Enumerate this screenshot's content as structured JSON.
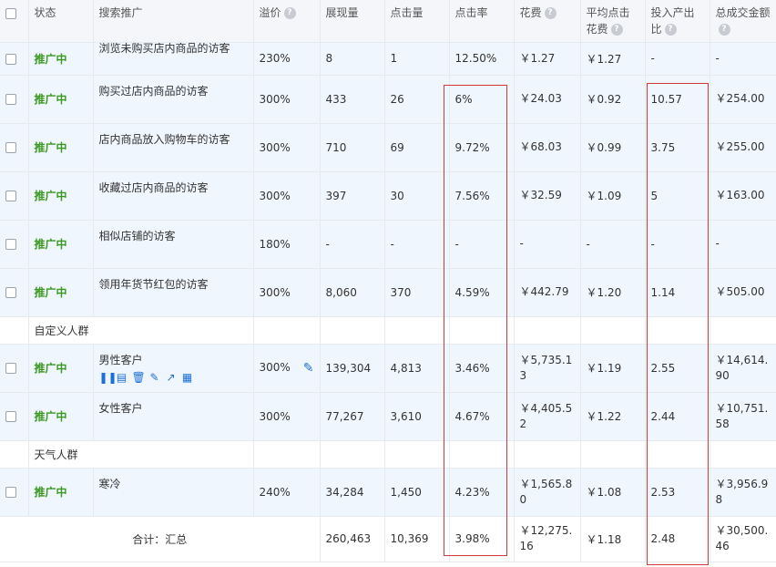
{
  "headers": {
    "status": "状态",
    "name": "搜索推广",
    "premium": "溢价",
    "impressions": "展现量",
    "clicks": "点击量",
    "ctr": "点击率",
    "cost": "花费",
    "cpc": "平均点击花费",
    "roi": "投入产出比",
    "gmv": "总成交金额"
  },
  "rows": [
    {
      "status": "推广中",
      "name": "浏览未购买店内商品的访客",
      "premium": "230%",
      "impressions": "8",
      "clicks": "1",
      "ctr": "12.50%",
      "cost": "￥1.27",
      "cpc": "￥1.27",
      "roi": "-",
      "gmv": "-"
    },
    {
      "status": "推广中",
      "name": "购买过店内商品的访客",
      "premium": "300%",
      "impressions": "433",
      "clicks": "26",
      "ctr": "6%",
      "cost": "￥24.03",
      "cpc": "￥0.92",
      "roi": "10.57",
      "gmv": "￥254.00"
    },
    {
      "status": "推广中",
      "name": "店内商品放入购物车的访客",
      "premium": "300%",
      "impressions": "710",
      "clicks": "69",
      "ctr": "9.72%",
      "cost": "￥68.03",
      "cpc": "￥0.99",
      "roi": "3.75",
      "gmv": "￥255.00"
    },
    {
      "status": "推广中",
      "name": "收藏过店内商品的访客",
      "premium": "300%",
      "impressions": "397",
      "clicks": "30",
      "ctr": "7.56%",
      "cost": "￥32.59",
      "cpc": "￥1.09",
      "roi": "5",
      "gmv": "￥163.00"
    },
    {
      "status": "推广中",
      "name": "相似店铺的访客",
      "premium": "180%",
      "impressions": "-",
      "clicks": "-",
      "ctr": "-",
      "cost": "-",
      "cpc": "-",
      "roi": "-",
      "gmv": "-"
    },
    {
      "status": "推广中",
      "name": "领用年货节红包的访客",
      "premium": "300%",
      "impressions": "8,060",
      "clicks": "370",
      "ctr": "4.59%",
      "cost": "￥442.79",
      "cpc": "￥1.20",
      "roi": "1.14",
      "gmv": "￥505.00"
    }
  ],
  "group1": "自定义人群",
  "rows2": [
    {
      "status": "推广中",
      "name": "男性客户",
      "premium": "300%",
      "impressions": "139,304",
      "clicks": "4,813",
      "ctr": "3.46%",
      "cost": "￥5,735.13",
      "cpc": "￥1.19",
      "roi": "2.55",
      "gmv": "￥14,614.90"
    },
    {
      "status": "推广中",
      "name": "女性客户",
      "premium": "300%",
      "impressions": "77,267",
      "clicks": "3,610",
      "ctr": "4.67%",
      "cost": "￥4,405.52",
      "cpc": "￥1.22",
      "roi": "2.44",
      "gmv": "￥10,751.58"
    }
  ],
  "group2": "天气人群",
  "rows3": [
    {
      "status": "推广中",
      "name": "寒冷",
      "premium": "240%",
      "impressions": "34,284",
      "clicks": "1,450",
      "ctr": "4.23%",
      "cost": "￥1,565.80",
      "cpc": "￥1.08",
      "roi": "2.53",
      "gmv": "￥3,956.98"
    }
  ],
  "total": {
    "label": "合计：汇总",
    "impressions": "260,463",
    "clicks": "10,369",
    "ctr": "3.98%",
    "cost": "￥12,275.16",
    "cpc": "￥1.18",
    "roi": "2.48",
    "gmv": "￥30,500.46"
  },
  "icons": [
    "pause-icon",
    "report-icon",
    "delete-icon",
    "edit-icon",
    "trend-icon",
    "chart-icon"
  ],
  "highlight_color": "#d23a3a",
  "status_color": "#3a9a1f"
}
